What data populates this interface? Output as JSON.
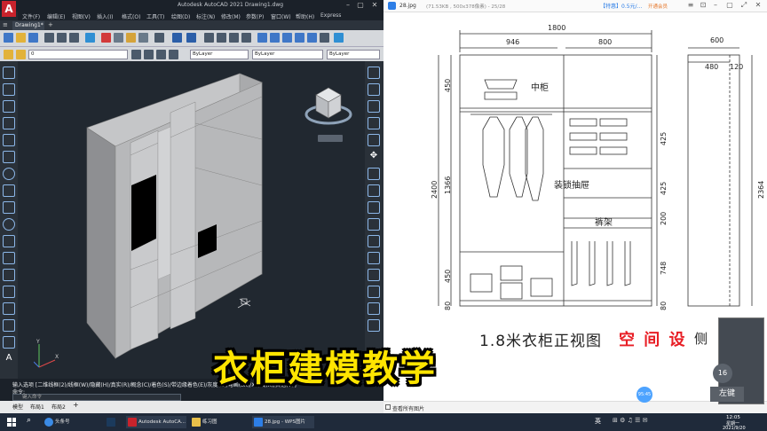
{
  "autocad": {
    "logo": "A",
    "title": "Autodesk AutoCAD 2021    Drawing1.dwg",
    "menu": [
      "文件(F)",
      "编辑(E)",
      "视图(V)",
      "插入(I)",
      "格式(O)",
      "工具(T)",
      "绘图(D)",
      "标注(N)",
      "修改(M)",
      "参数(P)",
      "窗口(W)",
      "帮助(H)",
      "Express"
    ],
    "tab": "Drawing1*",
    "layer_value": "0",
    "bylayer_1": "ByLayer",
    "bylayer_2": "ByLayer",
    "bylayer_3": "ByLayer",
    "command_options": "输入选项 [二维线框(2)/线框(W)/隐藏(H)/真实(R)/概念(C)/着色(S)/带边缘着色(E)/灰度(G)/勾画(SK)/X射线(X)/其他(O)]",
    "command_prompt": "命令:",
    "command_placeholder": "键入命令",
    "status_tabs": [
      "模型",
      "布局1",
      "布局2"
    ],
    "axis_x": "X",
    "axis_y": "Y"
  },
  "viewer": {
    "filename": "28.jpg",
    "meta": "(71.53KB , 500x378像素) - 25/28",
    "pro_label": "【特惠】0.5元/...",
    "open_label": "开通会员",
    "view_all": "查看所有图片",
    "zoom": "95:45",
    "caption_black": "1.8米衣柜正视图",
    "caption_red": "空 间 设",
    "caption_tail": "侧",
    "webcam_num": "16",
    "left_key": "左键",
    "drawing": {
      "dim_total_width": "1800",
      "dim_left": "946",
      "dim_right": "800",
      "dim_side_width": "600",
      "dim_side_inner": "480",
      "dim_side_gap": "120",
      "dim_height_total": "2400",
      "dim_height_side": "2364",
      "dim_top": "450",
      "dim_middle": "1366",
      "dim_lower": "450",
      "dim_base": "80",
      "dim_r1": "425",
      "dim_r2": "425",
      "dim_r3": "200",
      "dim_r4": "748",
      "dim_r5": "80",
      "label_shelf": "中柜",
      "label_drawer": "装锁抽屉",
      "label_rack": "裤架"
    }
  },
  "subtitle": "衣柜建模教学",
  "taskbar": {
    "search_label": "头条号",
    "items": [
      "Autodesk AutoCA...",
      "练习图",
      "28.jpg - WPS图片"
    ],
    "tray": "英",
    "time": "12:05",
    "day": "星期一",
    "date": "2021/9/20"
  },
  "colors": {
    "accent_blue": "#2d7ee6",
    "caption_red": "#e81e25",
    "subtitle_yellow": "#ffe500",
    "autocad_red": "#c8232c"
  }
}
